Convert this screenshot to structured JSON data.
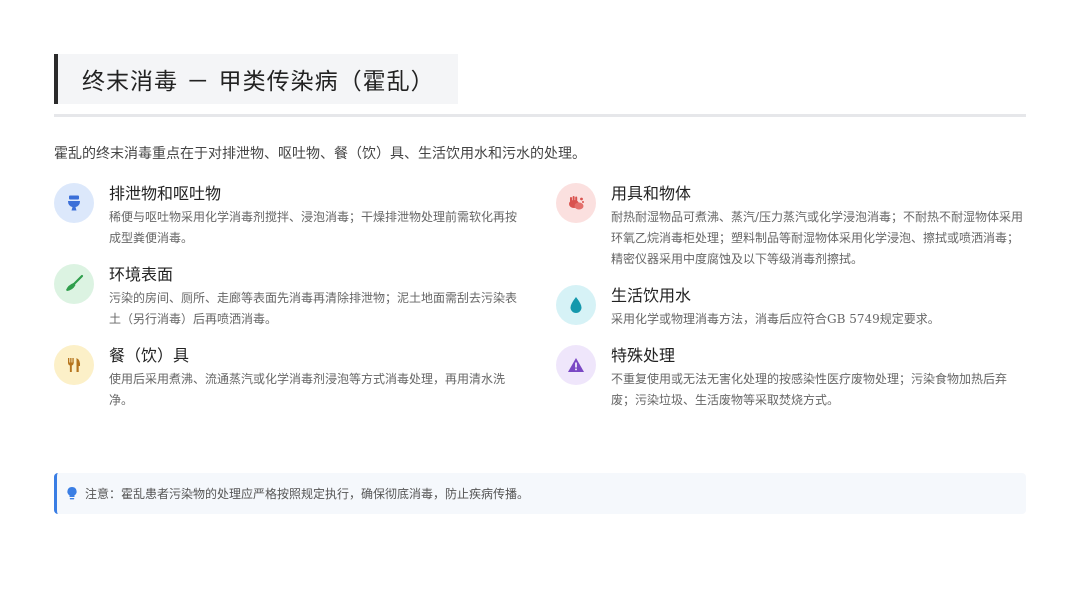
{
  "header": {
    "title": "终末消毒 － 甲类传染病（霍乱）"
  },
  "intro": "霍乱的终末消毒重点在于对排泄物、呕吐物、餐（饮）具、生活饮用水和污水的处理。",
  "items": [
    {
      "icon": "toilet-icon",
      "color": "#3b6fd8",
      "bg": "#dce8fb",
      "title": "排泄物和呕吐物",
      "desc": "稀便与呕吐物采用化学消毒剂搅拌、浸泡消毒；干燥排泄物处理前需软化再按成型粪便消毒。"
    },
    {
      "icon": "broom-icon",
      "color": "#2f9e4c",
      "bg": "#dcf3e2",
      "title": "环境表面",
      "desc": "污染的房间、厕所、走廊等表面先消毒再清除排泄物；泥土地面需刮去污染表土（另行消毒）后再喷洒消毒。"
    },
    {
      "icon": "utensils-icon",
      "color": "#b5731c",
      "bg": "#fcf0c8",
      "title": "餐（饮）具",
      "desc": "使用后采用煮沸、流通蒸汽或化学消毒剂浸泡等方式消毒处理，再用清水洗净。"
    },
    {
      "icon": "hands-icon",
      "color": "#d9534f",
      "bg": "#fbe0df",
      "title": "用具和物体",
      "desc": "耐热耐湿物品可煮沸、蒸汽/压力蒸汽或化学浸泡消毒；不耐热不耐湿物体采用环氧乙烷消毒柜处理；塑料制品等耐湿物体采用化学浸泡、擦拭或喷洒消毒；精密仪器采用中度腐蚀及以下等级消毒剂擦拭。"
    },
    {
      "icon": "water-drop-icon",
      "color": "#1598ac",
      "bg": "#d6f2f6",
      "title": "生活饮用水",
      "desc": "采用化学或物理消毒方法，消毒后应符合GB 5749规定要求。"
    },
    {
      "icon": "warning-icon",
      "color": "#7a48c4",
      "bg": "#efe6fb",
      "title": "特殊处理",
      "desc": "不重复使用或无法无害化处理的按感染性医疗废物处理；污染食物加热后弃废；污染垃圾、生活废物等采取焚烧方式。"
    }
  ],
  "note": {
    "icon": "lightbulb-icon",
    "text": "注意：霍乱患者污染物的处理应严格按照规定执行，确保彻底消毒，防止疾病传播。"
  }
}
